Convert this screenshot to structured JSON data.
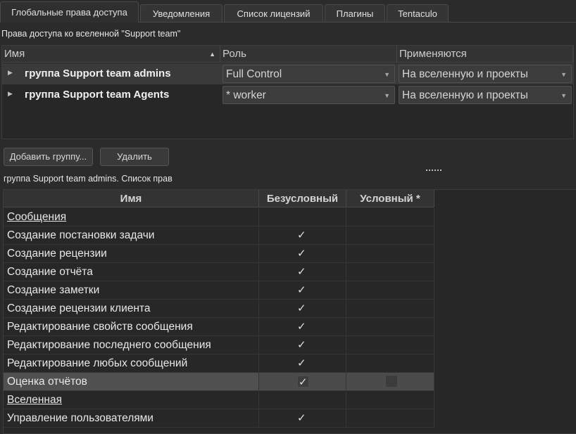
{
  "tabs": [
    {
      "label": "Глобальные права доступа",
      "active": true
    },
    {
      "label": "Уведомления"
    },
    {
      "label": "Список лицензий"
    },
    {
      "label": "Плагины"
    },
    {
      "label": "Tentaculo"
    }
  ],
  "universe_caption": "Права доступа ко вселенной \"Support team\"",
  "access_table": {
    "headers": {
      "name": "Имя",
      "role": "Роль",
      "applies": "Применяются"
    },
    "rows": [
      {
        "group": "группа Support team admins",
        "role": "Full Control",
        "applies": "На вселенную и проекты",
        "selected": true
      },
      {
        "group": "группа Support team Agents",
        "role": "* worker",
        "applies": "На вселенную и проекты"
      }
    ]
  },
  "buttons": {
    "add_group": "Добавить группу...",
    "delete": "Удалить"
  },
  "rights_caption": "группа Support team admins. Список прав",
  "rights_table": {
    "headers": {
      "name": "Имя",
      "unconditional": "Безусловный",
      "conditional": "Условный *"
    },
    "rows": [
      {
        "name": "Сообщения",
        "category": true
      },
      {
        "name": "Создание постановки задачи",
        "unconditional": true
      },
      {
        "name": "Создание рецензии",
        "unconditional": true
      },
      {
        "name": "Создание отчёта",
        "unconditional": true
      },
      {
        "name": "Создание заметки",
        "unconditional": true
      },
      {
        "name": "Создание рецензии клиента",
        "unconditional": true
      },
      {
        "name": "Редактирование свойств сообщения",
        "unconditional": true
      },
      {
        "name": "Редактирование последнего сообщения",
        "unconditional": true
      },
      {
        "name": "Редактирование любых сообщений",
        "unconditional": true
      },
      {
        "name": "Оценка отчётов",
        "unconditional": true,
        "conditional": false,
        "selected": true
      },
      {
        "name": "Вселенная",
        "category": true
      },
      {
        "name": "Управление пользователями",
        "unconditional": true
      }
    ]
  },
  "icons": {
    "check": "checkmark-icon",
    "expand": "expand-arrow-icon",
    "dropdown": "dropdown-arrow-icon",
    "sort": "sort-ascending-icon"
  }
}
